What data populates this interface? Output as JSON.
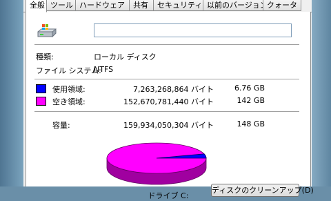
{
  "tabs": [
    {
      "label": "全般",
      "active": true
    },
    {
      "label": "ツール"
    },
    {
      "label": "ハードウェア"
    },
    {
      "label": "共有"
    },
    {
      "label": "セキュリティ"
    },
    {
      "label": "以前のバージョン"
    },
    {
      "label": "クォータ"
    }
  ],
  "general": {
    "name_value": "",
    "type_label": "種類:",
    "type_value": "ローカル ディスク",
    "fs_label": "ファイル システム:",
    "fs_value": "NTFS"
  },
  "space": {
    "used_label": "使用領域:",
    "used_bytes": "7,263,268,864 バイト",
    "used_size": "6.76 GB",
    "used_color": "#0000ff",
    "free_label": "空き領域:",
    "free_bytes": "152,670,781,440 バイト",
    "free_size": "142 GB",
    "free_color": "#ff00ff",
    "capacity_label": "容量:",
    "capacity_bytes": "159,934,050,304 バイト",
    "capacity_size": "148 GB",
    "used_fraction": 0.0454
  },
  "drive_label": "ドライブ C:",
  "cleanup_button": "ディスクのクリーンアップ(D)"
}
